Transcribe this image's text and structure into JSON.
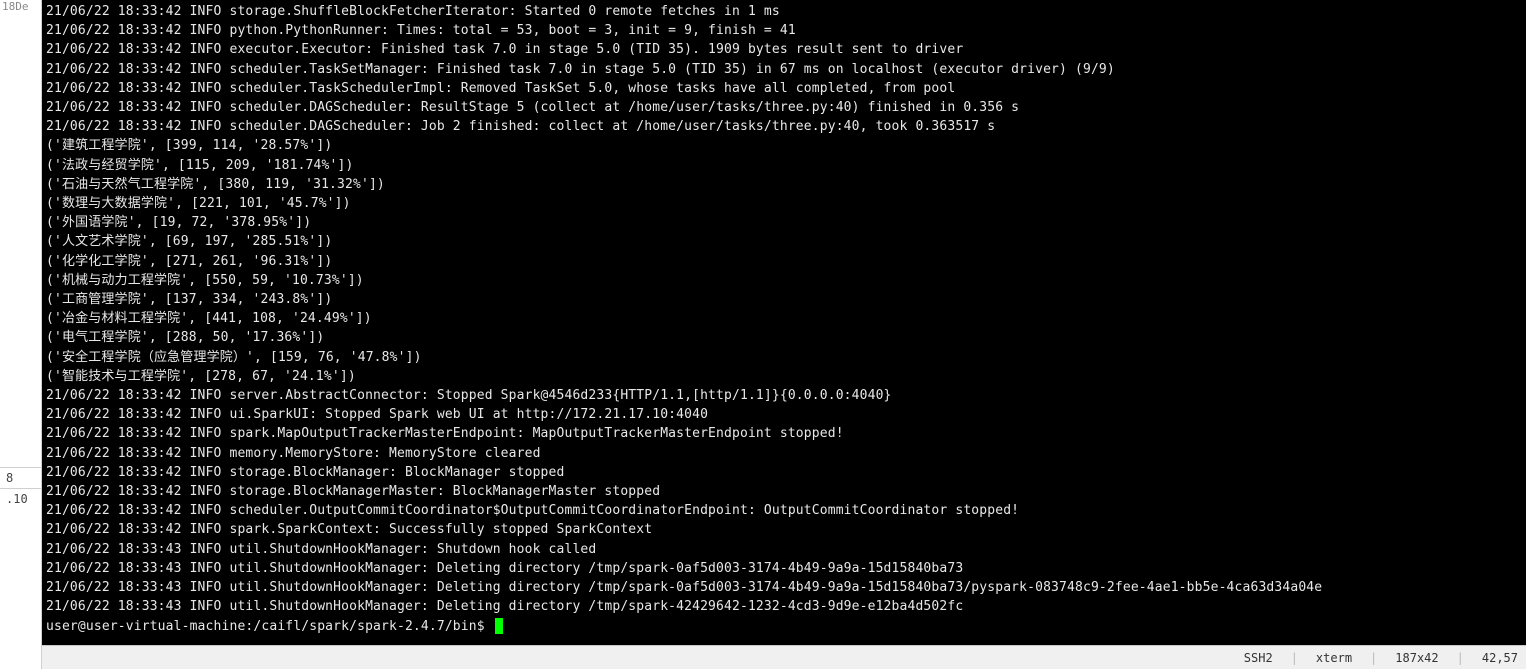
{
  "gutter": {
    "partial": "18De",
    "cells": [
      "8",
      ".10"
    ]
  },
  "terminal": {
    "lines": [
      "21/06/22 18:33:42 INFO storage.ShuffleBlockFetcherIterator: Started 0 remote fetches in 1 ms",
      "21/06/22 18:33:42 INFO python.PythonRunner: Times: total = 53, boot = 3, init = 9, finish = 41",
      "21/06/22 18:33:42 INFO executor.Executor: Finished task 7.0 in stage 5.0 (TID 35). 1909 bytes result sent to driver",
      "21/06/22 18:33:42 INFO scheduler.TaskSetManager: Finished task 7.0 in stage 5.0 (TID 35) in 67 ms on localhost (executor driver) (9/9)",
      "21/06/22 18:33:42 INFO scheduler.TaskSchedulerImpl: Removed TaskSet 5.0, whose tasks have all completed, from pool",
      "21/06/22 18:33:42 INFO scheduler.DAGScheduler: ResultStage 5 (collect at /home/user/tasks/three.py:40) finished in 0.356 s",
      "21/06/22 18:33:42 INFO scheduler.DAGScheduler: Job 2 finished: collect at /home/user/tasks/three.py:40, took 0.363517 s",
      "('建筑工程学院', [399, 114, '28.57%'])",
      "('法政与经贸学院', [115, 209, '181.74%'])",
      "('石油与天然气工程学院', [380, 119, '31.32%'])",
      "('数理与大数据学院', [221, 101, '45.7%'])",
      "('外国语学院', [19, 72, '378.95%'])",
      "('人文艺术学院', [69, 197, '285.51%'])",
      "('化学化工学院', [271, 261, '96.31%'])",
      "('机械与动力工程学院', [550, 59, '10.73%'])",
      "('工商管理学院', [137, 334, '243.8%'])",
      "('冶金与材料工程学院', [441, 108, '24.49%'])",
      "('电气工程学院', [288, 50, '17.36%'])",
      "('安全工程学院（应急管理学院）', [159, 76, '47.8%'])",
      "('智能技术与工程学院', [278, 67, '24.1%'])",
      "21/06/22 18:33:42 INFO server.AbstractConnector: Stopped Spark@4546d233{HTTP/1.1,[http/1.1]}{0.0.0.0:4040}",
      "21/06/22 18:33:42 INFO ui.SparkUI: Stopped Spark web UI at http://172.21.17.10:4040",
      "21/06/22 18:33:42 INFO spark.MapOutputTrackerMasterEndpoint: MapOutputTrackerMasterEndpoint stopped!",
      "21/06/22 18:33:42 INFO memory.MemoryStore: MemoryStore cleared",
      "21/06/22 18:33:42 INFO storage.BlockManager: BlockManager stopped",
      "21/06/22 18:33:42 INFO storage.BlockManagerMaster: BlockManagerMaster stopped",
      "21/06/22 18:33:42 INFO scheduler.OutputCommitCoordinator$OutputCommitCoordinatorEndpoint: OutputCommitCoordinator stopped!",
      "21/06/22 18:33:42 INFO spark.SparkContext: Successfully stopped SparkContext",
      "21/06/22 18:33:43 INFO util.ShutdownHookManager: Shutdown hook called",
      "21/06/22 18:33:43 INFO util.ShutdownHookManager: Deleting directory /tmp/spark-0af5d003-3174-4b49-9a9a-15d15840ba73",
      "21/06/22 18:33:43 INFO util.ShutdownHookManager: Deleting directory /tmp/spark-0af5d003-3174-4b49-9a9a-15d15840ba73/pyspark-083748c9-2fee-4ae1-bb5e-4ca63d34a04e",
      "21/06/22 18:33:43 INFO util.ShutdownHookManager: Deleting directory /tmp/spark-42429642-1232-4cd3-9d9e-e12ba4d502fc"
    ],
    "prompt": "user@user-virtual-machine:/caifl/spark/spark-2.4.7/bin$ "
  },
  "statusbar": {
    "protocol": "SSH2",
    "termtype": "xterm",
    "size": "187x42",
    "cursor": "42,57"
  },
  "watermark": ""
}
